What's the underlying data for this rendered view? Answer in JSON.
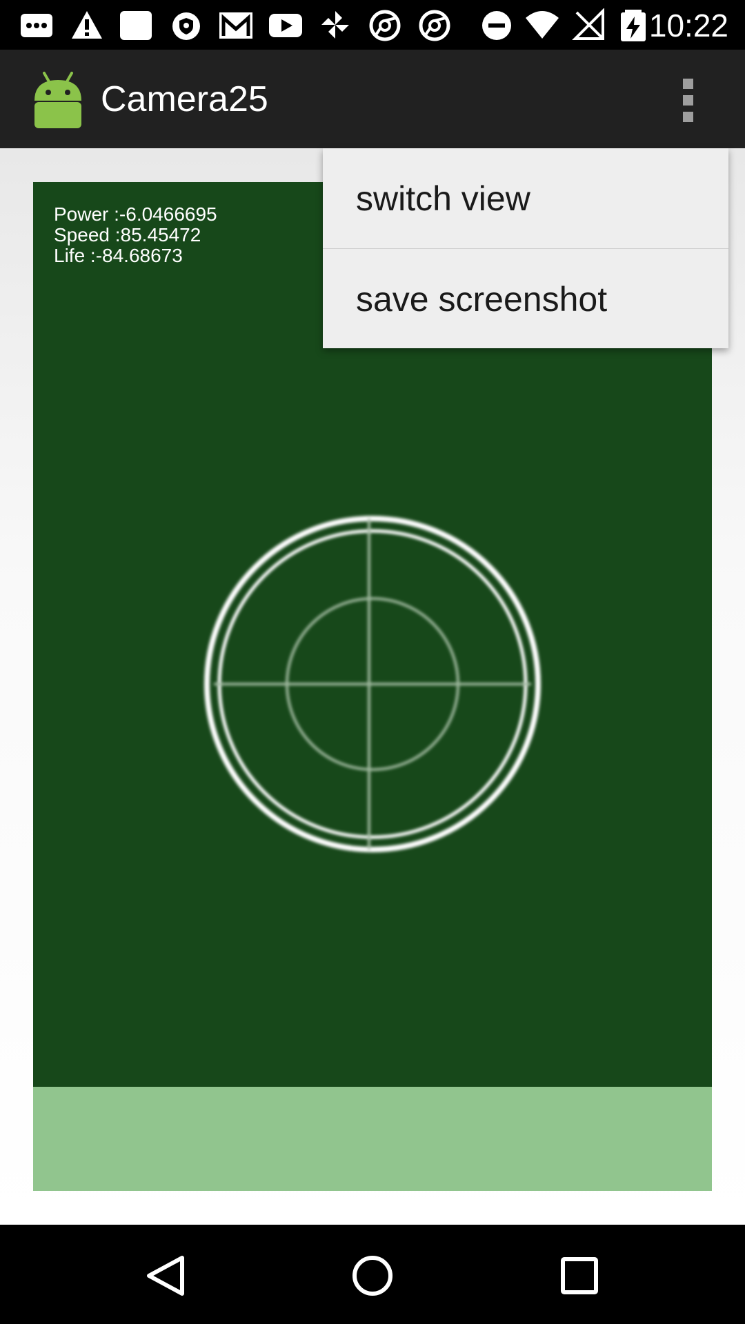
{
  "status_bar": {
    "time": "10:22",
    "icons": [
      "message-icon",
      "warning-icon",
      "image-icon",
      "shield-icon",
      "gmail-icon",
      "youtube-icon",
      "pinwheel-icon",
      "chrome-icon",
      "chrome-icon",
      "do-not-disturb-icon",
      "wifi-icon",
      "no-signal-icon",
      "battery-charging-icon"
    ]
  },
  "app_bar": {
    "title": "Camera25",
    "logo": "android-icon",
    "menu_icon": "overflow-menu-icon"
  },
  "stats": {
    "power": "Power :-6.0466695",
    "speed": "Speed :85.45472",
    "life": "Life :-84.68673"
  },
  "menu": {
    "items": [
      {
        "label": "switch view"
      },
      {
        "label": "save screenshot"
      }
    ]
  },
  "nav_bar": {
    "buttons": [
      "back-icon",
      "home-icon",
      "recents-icon"
    ]
  },
  "colors": {
    "camera_bg": "#17481a",
    "bottom_panel": "#91c58e",
    "app_bar": "#212121",
    "menu_bg": "#eeeeee"
  }
}
